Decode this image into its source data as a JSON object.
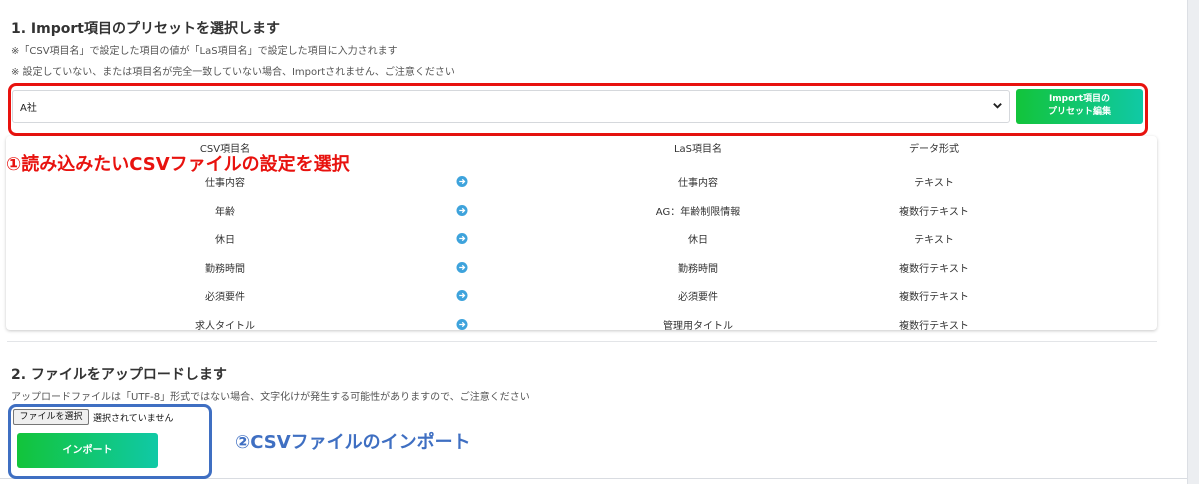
{
  "section1": {
    "title": "1. Import項目のプリセットを選択します",
    "note1": "※「CSV項目名」で設定した項目の値が「LaS項目名」で設定した項目に入力されます",
    "note2": "※ 設定していない、または項目名が完全一致していない場合、Importされません、ご注意ください"
  },
  "preset": {
    "selected": "A社",
    "edit_button_line1": "Import項目の",
    "edit_button_line2": "プリセット編集"
  },
  "mapping": {
    "headers": {
      "csv": "CSV項目名",
      "las": "LaS項目名",
      "format": "データ形式"
    },
    "rows": [
      {
        "csv": "仕事内容",
        "las": "仕事内容",
        "format": "テキスト"
      },
      {
        "csv": "年齢",
        "las": "AG：年齢制限情報",
        "format": "複数行テキスト"
      },
      {
        "csv": "休日",
        "las": "休日",
        "format": "テキスト"
      },
      {
        "csv": "勤務時間",
        "las": "勤務時間",
        "format": "複数行テキスト"
      },
      {
        "csv": "必須要件",
        "las": "必須要件",
        "format": "複数行テキスト"
      },
      {
        "csv": "求人タイトル",
        "las": "管理用タイトル",
        "format": "複数行テキスト"
      }
    ]
  },
  "annotations": {
    "step1": "①読み込みたいCSVファイルの設定を選択",
    "step2": "②CSVファイルのインポート"
  },
  "section2": {
    "title": "2. ファイルをアップロードします",
    "note": "アップロードファイルは「UTF-8」形式ではない場合、文字化けが発生する可能性がありますので、ご注意ください"
  },
  "file": {
    "choose_label": "ファイルを選択",
    "status": "選択されていません"
  },
  "import_button": "インポート",
  "colors": {
    "accent_green_start": "#12c43a",
    "accent_green_end": "#10c9a6",
    "annotation_red": "#e8120e",
    "annotation_blue": "#3f6fc2",
    "arrow_blue": "#3ea3dc"
  },
  "icons": {
    "row_arrow": "arrow-right-circle-icon",
    "select_chevron": "chevron-down-icon"
  }
}
